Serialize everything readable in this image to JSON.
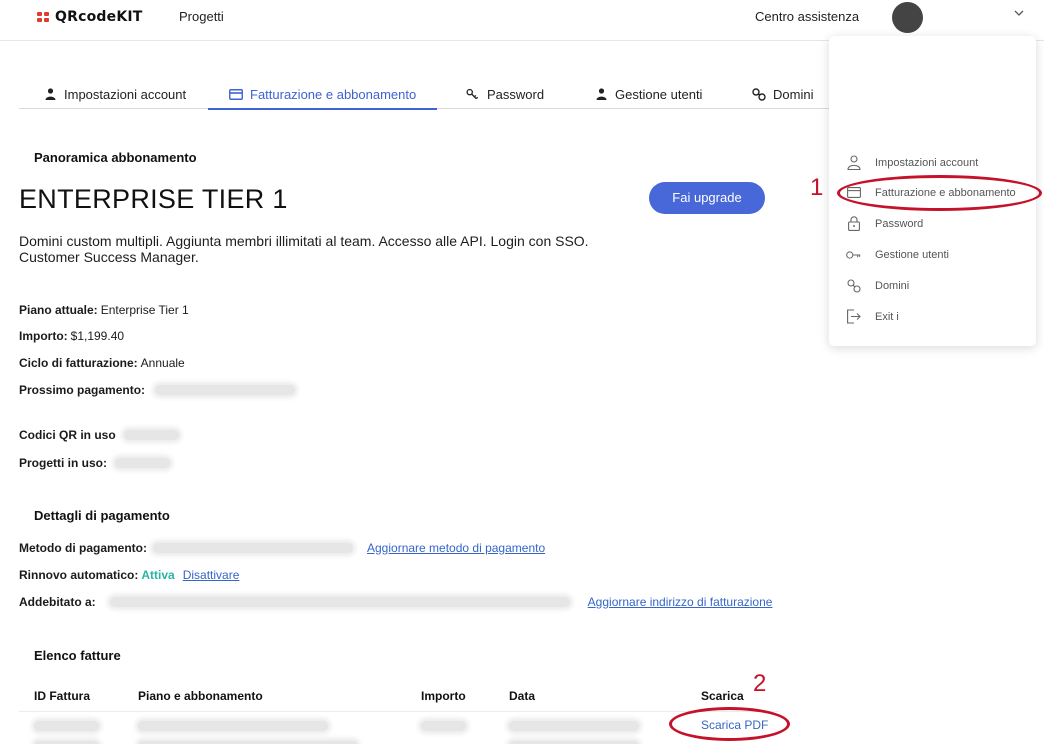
{
  "header": {
    "logo_text": "QRcodeKIT",
    "nav_projects": "Progetti",
    "help_label": "Centro assistenza"
  },
  "tabs": [
    {
      "label": "Impostazioni account",
      "icon": "user-icon"
    },
    {
      "label": "Fatturazione e abbonamento",
      "icon": "credit-card-icon",
      "active": true
    },
    {
      "label": "Password",
      "icon": "key-icon"
    },
    {
      "label": "Gestione utenti",
      "icon": "user-icon"
    },
    {
      "label": "Domini",
      "icon": "link-icon"
    }
  ],
  "overview": {
    "section_title": "Panoramica abbonamento",
    "plan_name": "ENTERPRISE TIER 1",
    "upgrade_label": "Fai upgrade",
    "description": "Domini custom multipli. Aggiunta membri illimitati al team. Accesso alle API. Login con SSO. Customer Success Manager.",
    "current_plan_label": "Piano attuale:",
    "current_plan_value": "Enterprise Tier 1",
    "amount_label": "Importo:",
    "amount_value": "$1,199.40",
    "cycle_label": "Ciclo di fatturazione:",
    "cycle_value": "Annuale",
    "next_payment_label": "Prossimo pagamento:",
    "qr_in_use_label": "Codici QR in uso",
    "projects_in_use_label": "Progetti in uso:"
  },
  "payment": {
    "section_title": "Dettagli di pagamento",
    "method_label": "Metodo di pagamento:",
    "update_method_link": "Aggiornare metodo di pagamento",
    "auto_renew_label": "Rinnovo automatico:",
    "auto_renew_status": "Attiva",
    "disable_link": "Disattivare",
    "billed_to_label": "Addebitato a:",
    "update_address_link": "Aggiornare indirizzo di fatturazione"
  },
  "invoices": {
    "section_title": "Elenco fatture",
    "columns": [
      "ID Fattura",
      "Piano e abbonamento",
      "Importo",
      "Data",
      "Scarica"
    ],
    "download_label": "Scarica PDF"
  },
  "dropdown": {
    "items": [
      {
        "label": "Impostazioni account",
        "icon": "person-icon"
      },
      {
        "label": "Fatturazione e abbonamento",
        "icon": "credit-card-icon"
      },
      {
        "label": "Password",
        "icon": "lock-icon"
      },
      {
        "label": "Gestione utenti",
        "icon": "key-icon"
      },
      {
        "label": "Domini",
        "icon": "link-icon"
      },
      {
        "label": "Exit i",
        "icon": "logout-icon"
      }
    ]
  },
  "annotations": {
    "marker_1": "1",
    "marker_2": "2",
    "color": "#c4122b"
  },
  "colors": {
    "accent": "#3e63d2",
    "button": "#4867d8",
    "link": "#3666c8",
    "active_status": "#2bb3a8",
    "logo_red": "#e23b2e"
  }
}
